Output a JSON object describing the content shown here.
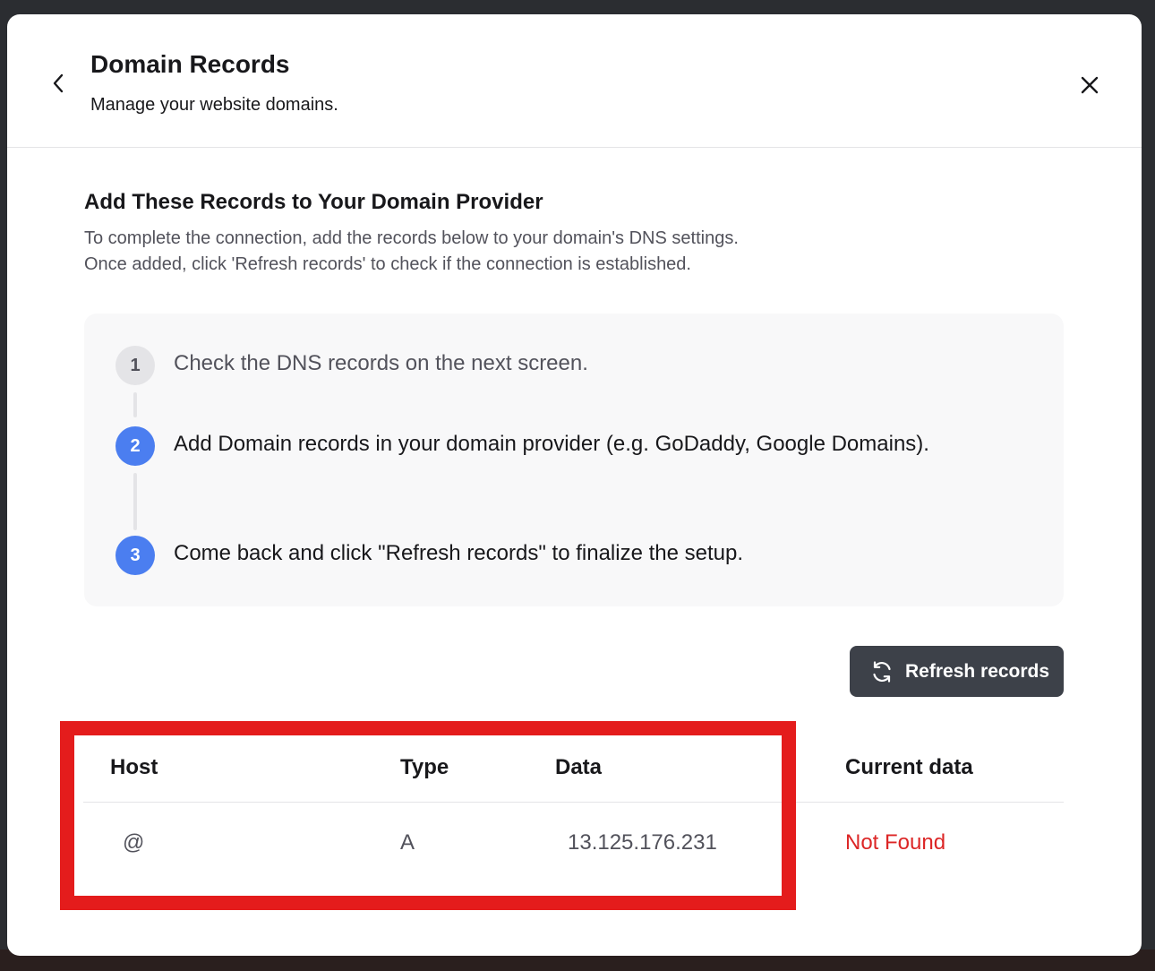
{
  "header": {
    "title": "Domain Records",
    "subtitle": "Manage your website domains."
  },
  "section": {
    "title": "Add These Records to Your Domain Provider",
    "desc_line1": "To complete the connection, add the records below to your domain's DNS settings.",
    "desc_line2": "Once added, click 'Refresh records' to check if the connection is established."
  },
  "steps": [
    {
      "number": "1",
      "text": "Check the DNS records on the next screen.",
      "state": "done"
    },
    {
      "number": "2",
      "text": "Add Domain records in your domain provider (e.g. GoDaddy, Google Domains).",
      "state": "active"
    },
    {
      "number": "3",
      "text": "Come back and click \"Refresh records\" to finalize the setup.",
      "state": "active"
    }
  ],
  "refresh_button": {
    "label": "Refresh records",
    "icon": "refresh-icon"
  },
  "table": {
    "headers": [
      "Host",
      "Type",
      "Data",
      "Current data"
    ],
    "rows": [
      {
        "host": "@",
        "type": "A",
        "data": "13.125.176.231",
        "current": "Not Found"
      }
    ]
  },
  "colors": {
    "accent": "#4b7ef0",
    "button_bg": "#3d4149",
    "error": "#dc2626",
    "highlight": "#e41c1c"
  }
}
